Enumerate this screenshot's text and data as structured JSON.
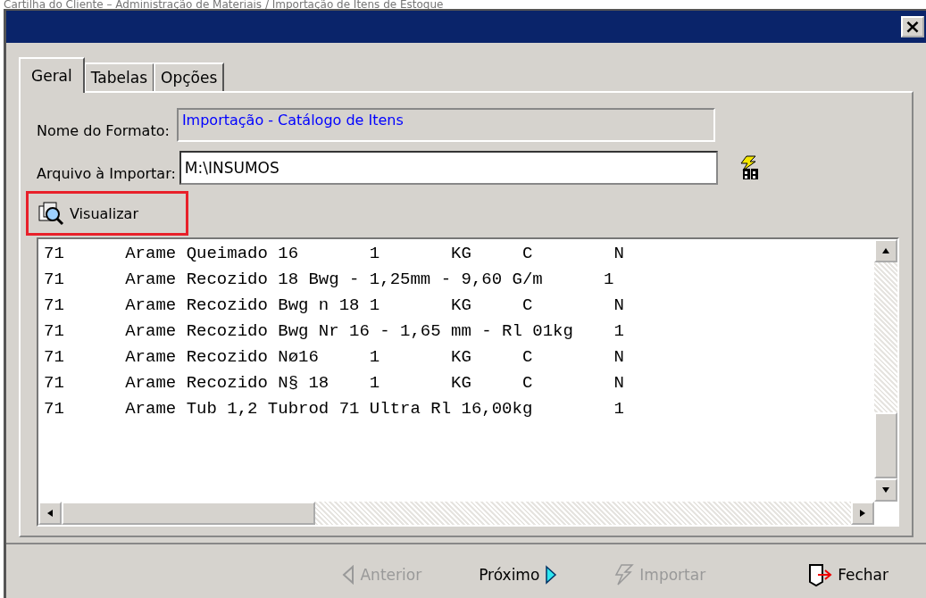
{
  "caption": "Cartilha do Cliente – Administração de Materiais / Importação de Itens de Estoque",
  "window": {
    "close": "×"
  },
  "tabs": [
    {
      "label": "Geral",
      "selected": true
    },
    {
      "label": "Tabelas",
      "selected": false
    },
    {
      "label": "Opções",
      "selected": false
    }
  ],
  "format_name": {
    "label": "Nome do Formato:",
    "value": "Importação - Catálogo de Itens"
  },
  "import_file": {
    "label": "Arquivo à Importar:",
    "value": "M:\\INSUMOS"
  },
  "preview_button": {
    "label": "Visualizar",
    "highlighted": true
  },
  "preview_lines": [
    "71      Arame Queimado 16       1       KG     C        N",
    "71      Arame Recozido 18 Bwg - 1,25mm - 9,60 G/m      1",
    "71      Arame Recozido Bwg n 18 1       KG     C        N",
    "71      Arame Recozido Bwg Nr 16 - 1,65 mm - Rl 01kg    1",
    "71      Arame Recozido Nø16     1       KG     C        N",
    "71      Arame Recozido N§ 18    1       KG     C        N",
    "71      Arame Tub 1,2 Tubrod 71 Ultra Rl 16,00kg        1"
  ],
  "buttons": [
    {
      "kind": "back",
      "label": "Anterior",
      "disabled": true
    },
    {
      "kind": "next",
      "label": "Próximo",
      "disabled": false
    },
    {
      "kind": "import",
      "label": "Importar",
      "disabled": true
    },
    {
      "kind": "close",
      "label": "Fechar",
      "disabled": false
    }
  ]
}
